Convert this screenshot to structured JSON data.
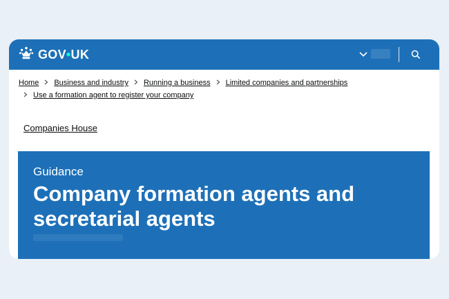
{
  "header": {
    "logo_text_left": "GOV",
    "logo_dot": "•",
    "logo_text_right": "UK",
    "icons": {
      "crown": "crown-icon",
      "menu": "chevron-down-icon",
      "search": "search-icon"
    }
  },
  "breadcrumbs": [
    "Home",
    "Business and industry",
    "Running a business",
    "Limited companies and partnerships",
    "Use a formation agent to register your company"
  ],
  "organisation": "Companies House",
  "hero": {
    "document_type": "Guidance",
    "title": "Company formation agents and secretarial agents"
  },
  "colors": {
    "brand_blue": "#1d70b8",
    "background": "#e9f0f7",
    "text": "#0b0c0c"
  }
}
